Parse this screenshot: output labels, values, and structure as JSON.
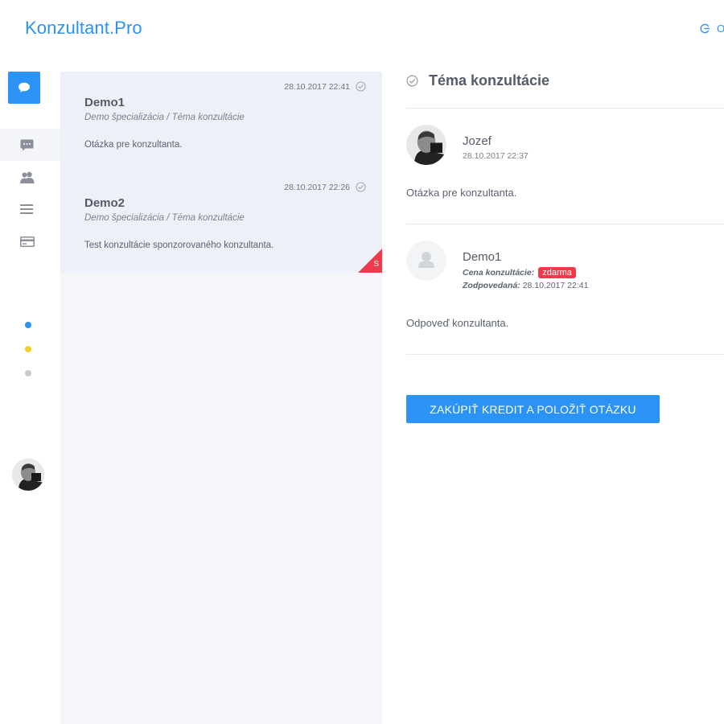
{
  "app": {
    "brand": "Konzultant.Pro"
  },
  "header": {
    "action_icon": "logout-icon",
    "action_label": "Odhlásiť"
  },
  "sidebar": {
    "items": [
      {
        "name": "consultations",
        "icon": "chat-bubble-icon",
        "active": true
      },
      {
        "name": "consultants",
        "icon": "users-icon",
        "active": false
      },
      {
        "name": "menu",
        "icon": "menu-list-icon",
        "active": false
      },
      {
        "name": "payments",
        "icon": "credit-card-icon",
        "active": false
      }
    ],
    "status_dots": [
      "#2a93f5",
      "#f5d020",
      "#c8c8c8"
    ]
  },
  "conversations": [
    {
      "datetime": "28.10.2017 22:41",
      "title": "Demo1",
      "subtitle": "Demo špecializácia / Téma konzultácie",
      "excerpt": "Otázka pre konzultanta.",
      "corner_label": ""
    },
    {
      "datetime": "28.10.2017 22:26",
      "title": "Demo2",
      "subtitle": "Demo špecializácia / Téma konzultácie",
      "excerpt": "Test konzultácie sponzorovaného konzultanta.",
      "corner_label": "S"
    }
  ],
  "detail": {
    "topic": "Téma konzultácie",
    "question": {
      "author": "Jozef",
      "datetime": "28.10.2017 22:37",
      "text": "Otázka pre konzultanta."
    },
    "answer": {
      "author": "Demo1",
      "price_label": "Cena konzultácie:",
      "price_value": "zdarma",
      "answered_label": "Zodpovedaná:",
      "answered_value": "28.10.2017 22:41",
      "text": "Odpoveď konzultanta."
    },
    "cta_label": "ZAKÚPIŤ KREDIT A POLOŽIŤ OTÁZKU"
  },
  "colors": {
    "accent": "#2a93f5",
    "danger": "#f03a4c",
    "warning": "#f5d020"
  }
}
